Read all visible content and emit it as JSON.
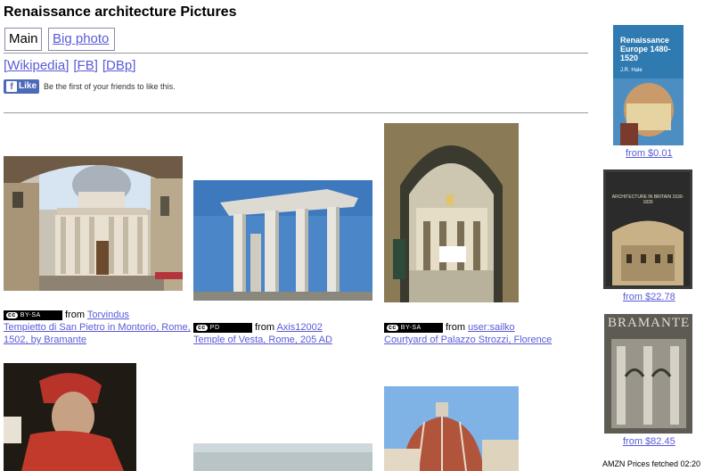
{
  "page": {
    "title": "Renaissance architecture Pictures"
  },
  "tabs": {
    "main": "Main",
    "big_photo": "Big photo"
  },
  "external_links": [
    "[Wikipedia]",
    "[FB]",
    "[DBp]"
  ],
  "facebook": {
    "like_label": "Like",
    "like_text": "Be the first of your friends to like this."
  },
  "photos": [
    {
      "license": "BY-SA",
      "from": "from",
      "author": "Torvindus",
      "caption": "Tempietto di San Pietro in Montorio, Rome, 1502, by Bramante"
    },
    {
      "license": "PD",
      "from": "from",
      "author": "Axis12002",
      "caption": "Temple of Vesta, Rome, 205 AD"
    },
    {
      "license": "BY-SA",
      "from": "from",
      "author": "user:sailko",
      "caption": "Courtyard of Palazzo Strozzi, Florence"
    }
  ],
  "books": [
    {
      "cover_title": "Renaissance Europe 1480-1520",
      "cover_author": "J.R. Hale",
      "price": "from $0.01"
    },
    {
      "cover_title": "ARCHITECTURE IN BRITAIN 1530-1830",
      "price": "from $22.78"
    },
    {
      "cover_title": "BRAMANTE",
      "price": "from $82.45"
    }
  ],
  "amzn_note": "AMZN Prices fetched 02:20",
  "colors": {
    "link": "#5a5ad8",
    "fb_blue": "#4c69ba"
  }
}
